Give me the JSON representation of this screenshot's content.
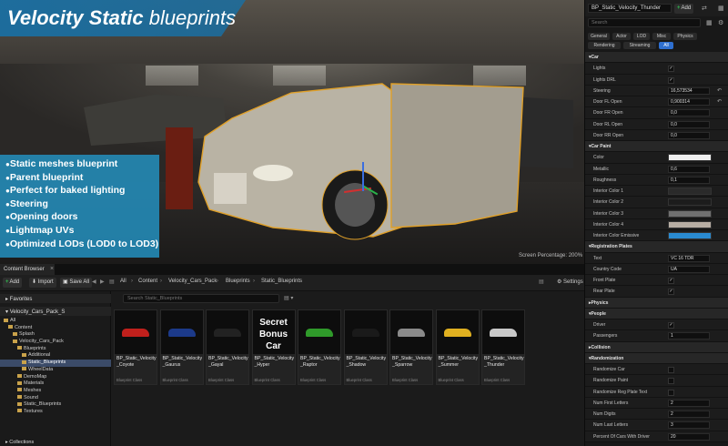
{
  "viewport": {
    "title_bold": "Velocity Static",
    "title_thin": "blueprints",
    "features": [
      "Static meshes blueprint",
      "Parent blueprint",
      "Perfect for baked lighting",
      "Steering",
      "Opening doors",
      "Lightmap UVs",
      "Optimized LODs (LOD0 to LOD3)"
    ],
    "screen_percentage": "Screen Percentage: 200%"
  },
  "content_browser": {
    "tab_label": "Content Browser",
    "add_label": "Add",
    "import_label": "Import",
    "save_all_label": "Save All",
    "settings_label": "Settings",
    "breadcrumb": [
      "All",
      "Content",
      "Velocity_Cars_Pack",
      "Blueprints",
      "Static_Blueprints"
    ],
    "favorites_label": "Favorites",
    "root_label": "Velocity_Cars_Pack_S",
    "search_placeholder": "Search Static_Blueprints",
    "collections_label": "Collections",
    "tree": [
      {
        "label": "All",
        "indent": 0
      },
      {
        "label": "Content",
        "indent": 1
      },
      {
        "label": "Splash",
        "indent": 2
      },
      {
        "label": "Velocity_Cars_Pack",
        "indent": 2
      },
      {
        "label": "Blueprints",
        "indent": 3
      },
      {
        "label": "Additional",
        "indent": 4
      },
      {
        "label": "Static_Blueprints",
        "indent": 4,
        "selected": true
      },
      {
        "label": "WheelData",
        "indent": 4
      },
      {
        "label": "DemoMap",
        "indent": 3
      },
      {
        "label": "Materials",
        "indent": 3
      },
      {
        "label": "Meshes",
        "indent": 3
      },
      {
        "label": "Sound",
        "indent": 3
      },
      {
        "label": "Static_Blueprints",
        "indent": 3
      },
      {
        "label": "Textures",
        "indent": 3
      }
    ],
    "assets": [
      {
        "name": "BP_Static_Velocity_Coyote",
        "class": "Blueprint Class",
        "color": "#c0201c"
      },
      {
        "name": "BP_Static_Velocity_Gaurus",
        "class": "Blueprint Class",
        "color": "#1c3a8a"
      },
      {
        "name": "BP_Static_Velocity_Gayal",
        "class": "Blueprint Class",
        "color": "#222222"
      },
      {
        "name": "BP_Static_Velocity_Hyper",
        "class": "Blueprint Class",
        "secret": "Secret Bonus Car",
        "color": "#3a3a3a"
      },
      {
        "name": "BP_Static_Velocity_Raptor",
        "class": "Blueprint Class",
        "color": "#2f9a2a"
      },
      {
        "name": "BP_Static_Velocity_Shadow",
        "class": "Blueprint Class",
        "color": "#1a1a1a"
      },
      {
        "name": "BP_Static_Velocity_Sparrow",
        "class": "Blueprint Class",
        "color": "#8a8a8a"
      },
      {
        "name": "BP_Static_Velocity_Summer",
        "class": "Blueprint Class",
        "color": "#e0b020"
      },
      {
        "name": "BP_Static_Velocity_Thunder",
        "class": "Blueprint Class",
        "color": "#c8c8c8"
      }
    ]
  },
  "details": {
    "object_name": "BP_Static_Velocity_Thunder",
    "add_label": "Add",
    "search_placeholder": "Search",
    "filters": [
      "General",
      "Actor",
      "LOD",
      "Misc",
      "Physics",
      "Rendering",
      "Streaming",
      "All"
    ],
    "active_filter": "All",
    "rows": [
      {
        "type": "cat",
        "label": "Car"
      },
      {
        "label": "Lights",
        "kind": "check",
        "value": "✓"
      },
      {
        "label": "Lights DRL",
        "kind": "check",
        "value": "✓"
      },
      {
        "label": "Steering",
        "kind": "num",
        "value": "16,573534",
        "reset": true
      },
      {
        "label": "Door FL Open",
        "kind": "num",
        "value": "0,900314",
        "reset": true
      },
      {
        "label": "Door FR Open",
        "kind": "num",
        "value": "0,0"
      },
      {
        "label": "Door RL Open",
        "kind": "num",
        "value": "0,0"
      },
      {
        "label": "Door RR Open",
        "kind": "num",
        "value": "0,0"
      },
      {
        "type": "cat",
        "label": "Car Paint"
      },
      {
        "label": "Color",
        "kind": "swatch",
        "color": "#efefef"
      },
      {
        "label": "Metallic",
        "kind": "num",
        "value": "0,6"
      },
      {
        "label": "Roughness",
        "kind": "num",
        "value": "0,1"
      },
      {
        "label": "Interior Color 1",
        "kind": "swatch",
        "color": "#2a2a2a"
      },
      {
        "label": "Interior Color 2",
        "kind": "swatch",
        "color": "#1c1c1c"
      },
      {
        "label": "Interior Color 3",
        "kind": "swatch",
        "color": "#707070"
      },
      {
        "label": "Interior Color 4",
        "kind": "swatch",
        "color": "#b8aea4"
      },
      {
        "label": "Interior Color Emissive",
        "kind": "swatch",
        "color": "#2a8ad0"
      },
      {
        "type": "cat",
        "label": "Registration Plates"
      },
      {
        "label": "Text",
        "kind": "num",
        "value": "VC 16 TDR"
      },
      {
        "label": "Country Code",
        "kind": "num",
        "value": "UA"
      },
      {
        "label": "Front Plate",
        "kind": "check",
        "value": "✓"
      },
      {
        "label": "Rear Plate",
        "kind": "check",
        "value": "✓"
      },
      {
        "type": "cat",
        "label": "Physics",
        "collapsed": true
      },
      {
        "type": "cat",
        "label": "People"
      },
      {
        "label": "Driver",
        "kind": "check",
        "value": "✓"
      },
      {
        "label": "Passengers",
        "kind": "num",
        "value": "1"
      },
      {
        "type": "cat",
        "label": "Collision",
        "collapsed": true
      },
      {
        "type": "cat",
        "label": "Randomization"
      },
      {
        "label": "Randomize Car",
        "kind": "check",
        "value": ""
      },
      {
        "label": "Randomize Paint",
        "kind": "check",
        "value": ""
      },
      {
        "label": "Randomize Reg Plate Text",
        "kind": "check",
        "value": ""
      },
      {
        "label": "Num First Letters",
        "kind": "num",
        "value": "2"
      },
      {
        "label": "Num Digits",
        "kind": "num",
        "value": "2"
      },
      {
        "label": "Num Last Letters",
        "kind": "num",
        "value": "3"
      },
      {
        "label": "Percent Of Cars With Driver",
        "kind": "num",
        "value": "20"
      }
    ]
  }
}
